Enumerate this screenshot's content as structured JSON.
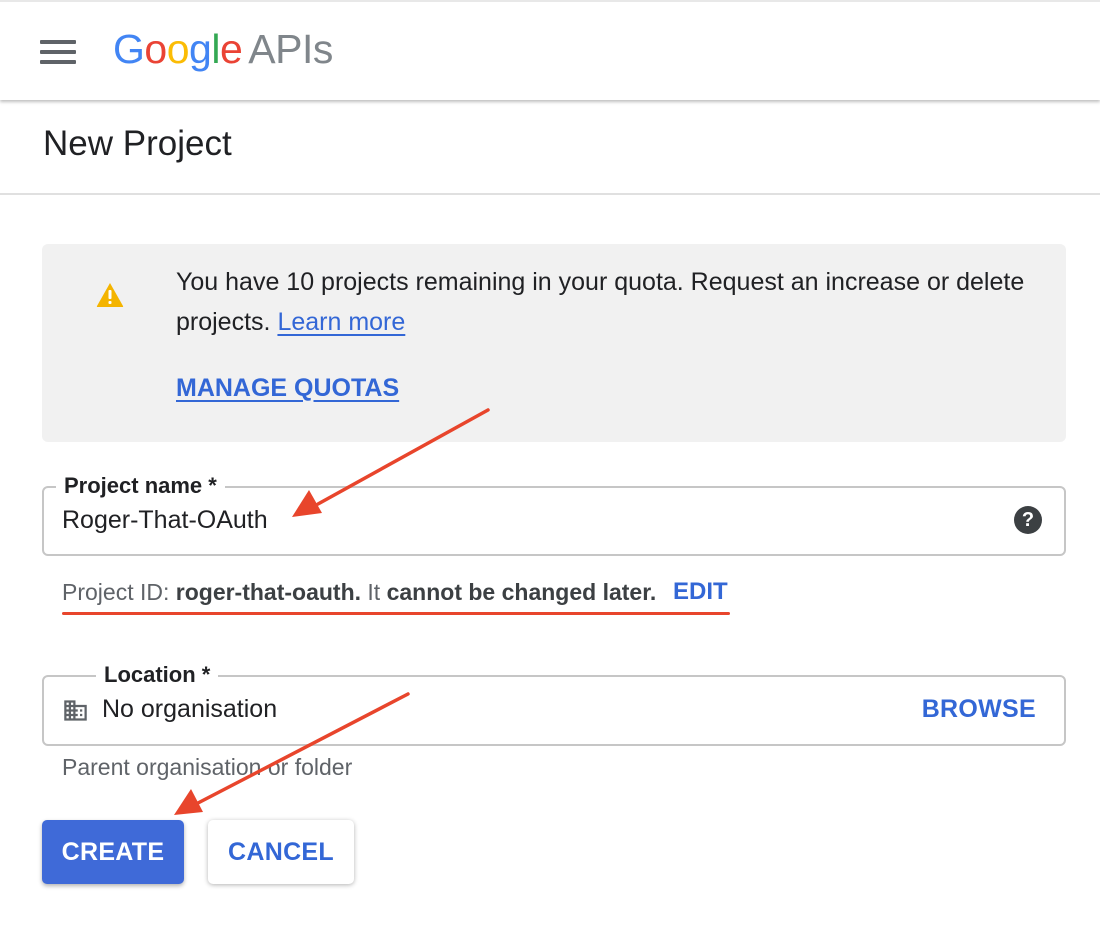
{
  "header": {
    "logo_google": [
      "G",
      "o",
      "o",
      "g",
      "l",
      "e"
    ],
    "logo_google_colors": [
      "#4285F4",
      "#EA4335",
      "#FBBC05",
      "#4285F4",
      "#34A853",
      "#EA4335"
    ],
    "logo_apis": "APIs"
  },
  "page": {
    "title": "New Project"
  },
  "quota_banner": {
    "text_before_link": "You have 10 projects remaining in your quota. Request an increase or delete projects.",
    "learn_more": "Learn more",
    "manage_quotas": "MANAGE QUOTAS"
  },
  "project_name_field": {
    "label": "Project name *",
    "value": "Roger-That-OAuth",
    "help_glyph": "?"
  },
  "project_id_hint": {
    "prefix": "Project ID:",
    "id": "roger-that-oauth.",
    "middle": "It",
    "warning": "cannot be changed later.",
    "edit": "EDIT"
  },
  "location_field": {
    "label": "Location *",
    "value": "No organisation",
    "browse": "BROWSE",
    "hint": "Parent organisation or folder"
  },
  "actions": {
    "create": "CREATE",
    "cancel": "CANCEL"
  },
  "colors": {
    "accent_blue": "#3367D6",
    "primary_button": "#3F6AD8",
    "warning_yellow": "#F4B400",
    "annotation_red": "#E8452C",
    "banner_bg": "#F1F1F1"
  },
  "icons": {
    "menu": "hamburger-menu-icon",
    "warning": "warning-triangle-icon",
    "help": "help-circle-icon",
    "location": "building-icon"
  }
}
